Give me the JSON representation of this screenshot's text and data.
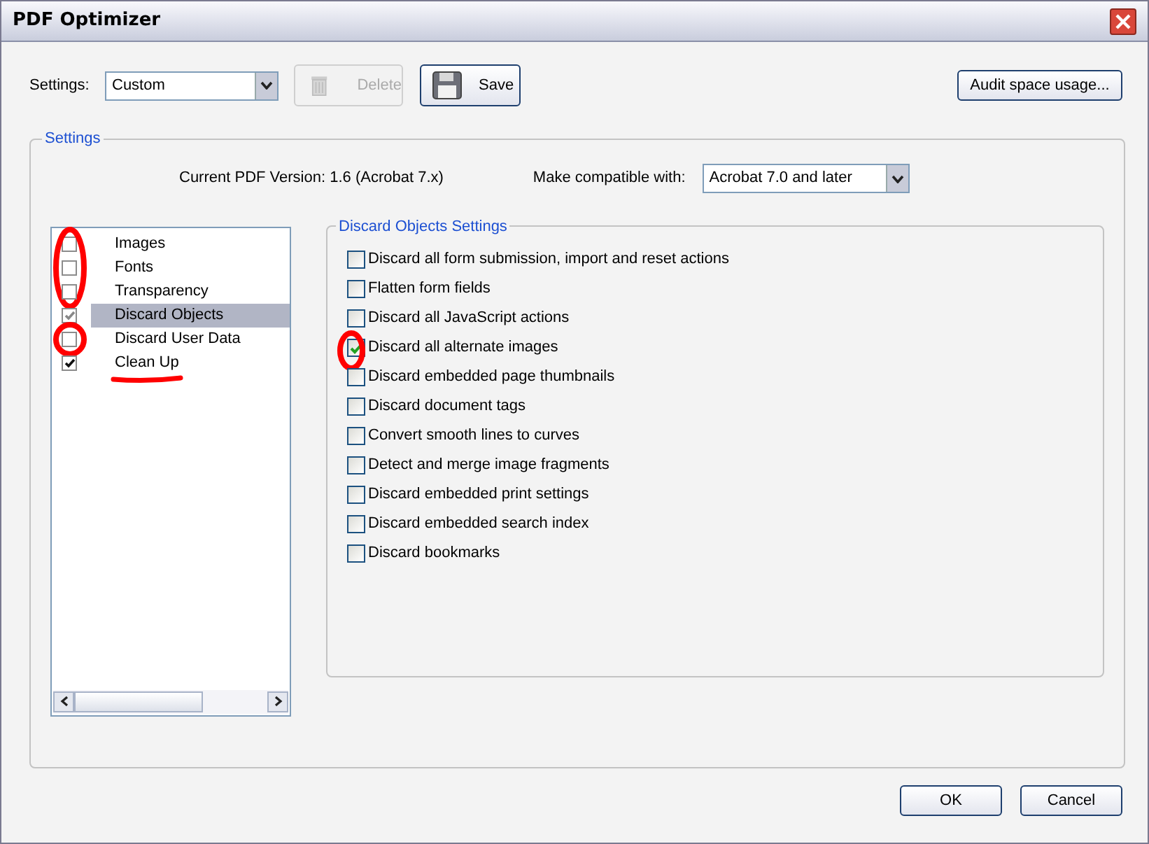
{
  "window": {
    "title": "PDF Optimizer"
  },
  "toolbar": {
    "settings_label": "Settings:",
    "settings_value": "Custom",
    "delete_button": {
      "label": "Delete",
      "disabled": true
    },
    "save_button": {
      "label": "Save",
      "disabled": false
    },
    "audit_button": "Audit space usage..."
  },
  "settings_group": {
    "title": "Settings",
    "current_version": "Current PDF Version: 1.6 (Acrobat 7.x)",
    "compatible_label": "Make compatible with:",
    "compatible_value": "Acrobat 7.0 and later"
  },
  "panels": [
    {
      "label": "Images",
      "checked": false,
      "selected": false,
      "circled": true,
      "underlined": false
    },
    {
      "label": "Fonts",
      "checked": false,
      "selected": false,
      "circled": true,
      "underlined": false
    },
    {
      "label": "Transparency",
      "checked": false,
      "selected": false,
      "circled": true,
      "underlined": false
    },
    {
      "label": "Discard Objects",
      "checked": true,
      "selected": true,
      "circled": false,
      "underlined": false
    },
    {
      "label": "Discard User Data",
      "checked": false,
      "selected": false,
      "circled": true,
      "underlined": false
    },
    {
      "label": "Clean Up",
      "checked": true,
      "selected": false,
      "circled": false,
      "underlined": true
    }
  ],
  "discard_objects": {
    "title": "Discard Objects Settings",
    "options": [
      {
        "label": "Discard all form submission, import and reset actions",
        "checked": false,
        "circled": false
      },
      {
        "label": "Flatten form fields",
        "checked": false,
        "circled": false
      },
      {
        "label": "Discard all JavaScript actions",
        "checked": false,
        "circled": false
      },
      {
        "label": "Discard all alternate images",
        "checked": true,
        "circled": true
      },
      {
        "label": "Discard embedded page thumbnails",
        "checked": false,
        "circled": false
      },
      {
        "label": "Discard document tags",
        "checked": false,
        "circled": false
      },
      {
        "label": "Convert smooth lines to curves",
        "checked": false,
        "circled": false
      },
      {
        "label": "Detect and merge image fragments",
        "checked": false,
        "circled": false
      },
      {
        "label": "Discard embedded print settings",
        "checked": false,
        "circled": false
      },
      {
        "label": "Discard embedded search index",
        "checked": false,
        "circled": false
      },
      {
        "label": "Discard bookmarks",
        "checked": false,
        "circled": false
      }
    ]
  },
  "buttons": [
    "OK",
    "Cancel"
  ]
}
